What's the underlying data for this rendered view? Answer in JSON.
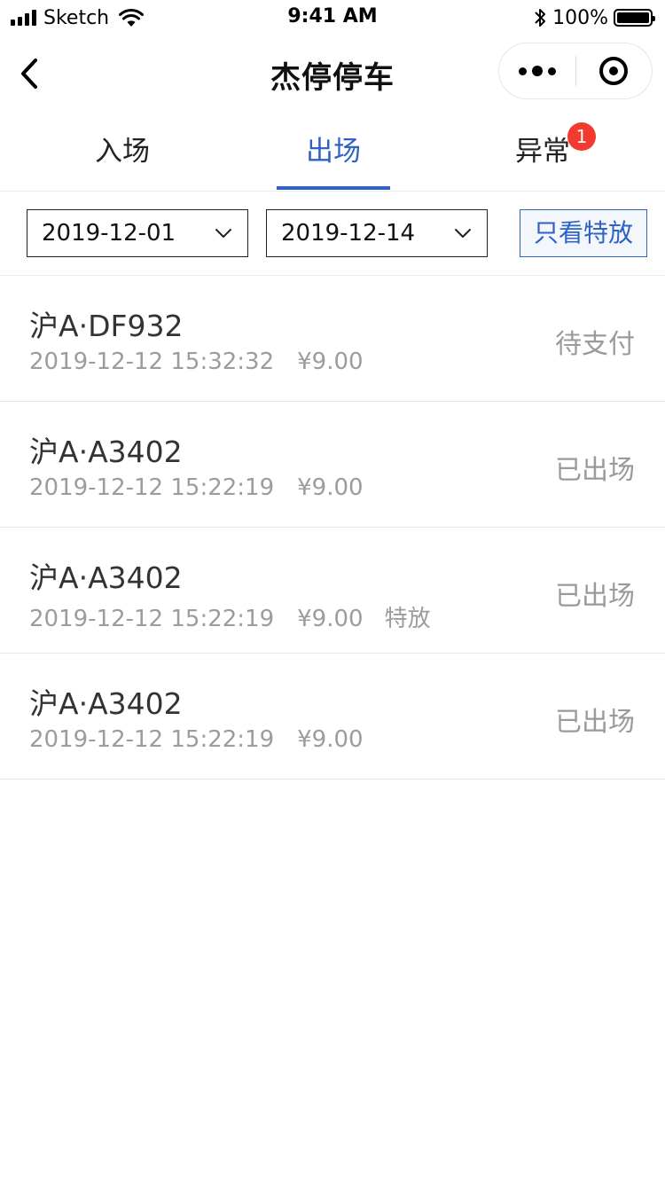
{
  "status_bar": {
    "carrier": "Sketch",
    "time": "9:41 AM",
    "battery": "100%",
    "icons": [
      "signal-icon",
      "wifi-icon",
      "bluetooth-icon",
      "battery-icon"
    ]
  },
  "nav": {
    "title": "杰停停车",
    "icons": [
      "back-icon",
      "more-icon",
      "target-icon"
    ]
  },
  "tabs": [
    {
      "label": "入场"
    },
    {
      "label": "出场"
    },
    {
      "label": "异常"
    }
  ],
  "active_tab": "出场",
  "badge": "1",
  "filters": {
    "start_date": "2019-12-01",
    "end_date": "2019-12-14",
    "special_label": "只看特放"
  },
  "colors": {
    "accent": "#2e62c3",
    "badge": "#f23a30",
    "muted_text": "#9c9c9c"
  },
  "records": [
    {
      "plate": "沪A·DF932",
      "time": "2019-12-12 15:32:32",
      "amount": "¥9.00",
      "tag": "",
      "status": "待支付"
    },
    {
      "plate": "沪A·A3402",
      "time": "2019-12-12 15:22:19",
      "amount": "¥9.00",
      "tag": "",
      "status": "已出场"
    },
    {
      "plate": "沪A·A3402",
      "time": "2019-12-12 15:22:19",
      "amount": "¥9.00",
      "tag": "特放",
      "status": "已出场"
    },
    {
      "plate": "沪A·A3402",
      "time": "2019-12-12 15:22:19",
      "amount": "¥9.00",
      "tag": "",
      "status": "已出场"
    }
  ]
}
